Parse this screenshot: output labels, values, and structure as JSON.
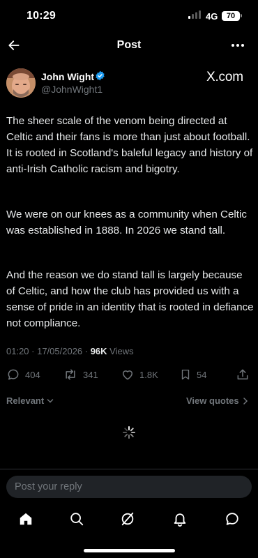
{
  "status_bar": {
    "time": "10:29",
    "network": "4G",
    "battery": "70"
  },
  "header": {
    "title": "Post"
  },
  "author": {
    "name": "John Wight",
    "handle": "@JohnWight1",
    "source_label": "X.com"
  },
  "post": {
    "paragraphs": [
      "The sheer scale of the venom being directed at Celtic and their fans is more than just about football. It is rooted in Scotland's baleful legacy and history of anti-Irish Catholic racism and bigotry.",
      "We were on our knees as a community when Celtic was established in 1888. In 2026 we stand tall.",
      "And the reason we do stand tall is largely because of Celtic, and how the club has provided us with a sense of pride in an identity that is rooted in defiance not compliance."
    ],
    "timestamp": "01:20 · 17/05/2026 · ",
    "views_count": "96K",
    "views_label": " Views"
  },
  "actions": {
    "replies": "404",
    "reposts": "341",
    "likes": "1.8K",
    "bookmarks": "54"
  },
  "replies_section": {
    "sort_label": "Relevant",
    "view_quotes_label": "View quotes"
  },
  "reply_box": {
    "placeholder": "Post your reply"
  },
  "colors": {
    "background": "#000000",
    "text": "#e7e9ea",
    "muted": "#71767b",
    "verified": "#1d9bf0",
    "input_bg": "#202327"
  },
  "icons": [
    "back-arrow-icon",
    "more-icon",
    "verified-icon",
    "reply-icon",
    "repost-icon",
    "like-icon",
    "bookmark-icon",
    "share-icon",
    "chevron-down-icon",
    "chevron-right-icon",
    "loading-spinner-icon",
    "home-icon",
    "search-icon",
    "grok-icon",
    "notifications-icon",
    "messages-icon"
  ]
}
